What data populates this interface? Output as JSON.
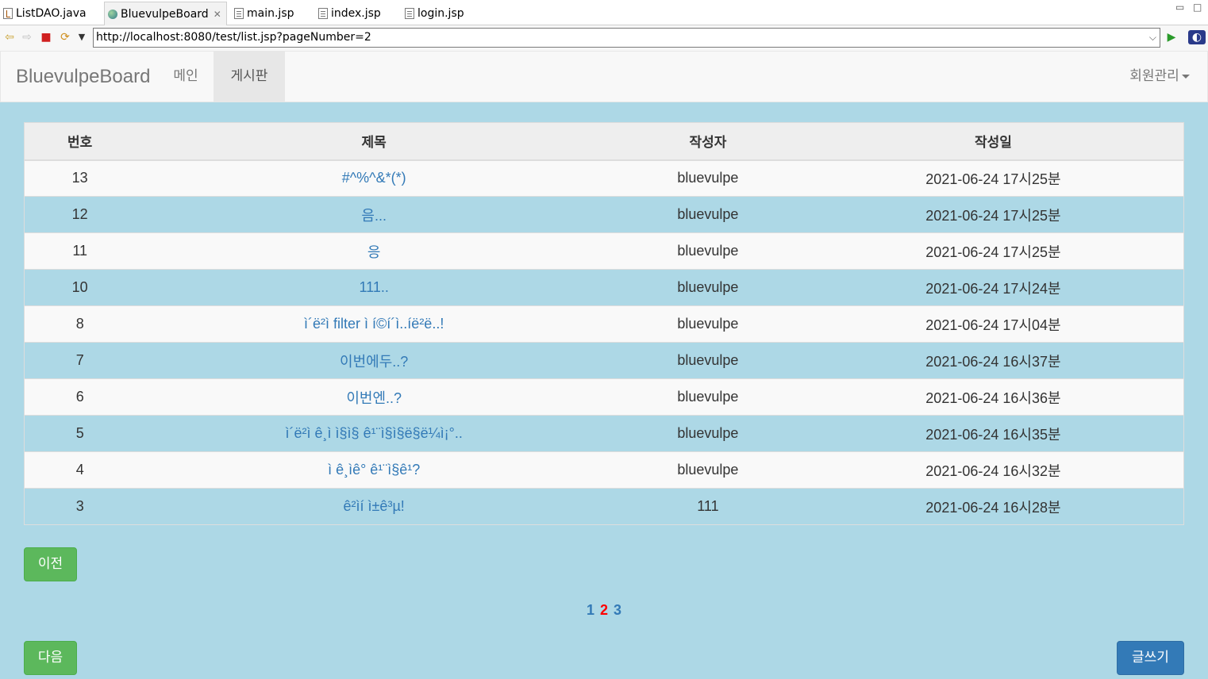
{
  "editor_tabs": [
    {
      "label": "ListDAO.java",
      "icon": "java-file-icon"
    },
    {
      "label": "BluevulpeBoard",
      "icon": "globe-icon",
      "active": true
    },
    {
      "label": "main.jsp",
      "icon": "jsp-file-icon"
    },
    {
      "label": "index.jsp",
      "icon": "jsp-file-icon"
    },
    {
      "label": "login.jsp",
      "icon": "jsp-file-icon"
    }
  ],
  "browser": {
    "url": "http://localhost:8080/test/list.jsp?pageNumber=2"
  },
  "navbar": {
    "brand": "BluevulpeBoard",
    "items": [
      {
        "label": "메인"
      },
      {
        "label": "게시판",
        "active": true
      }
    ],
    "user_menu": "회원관리"
  },
  "table": {
    "headers": [
      "번호",
      "제목",
      "작성자",
      "작성일"
    ],
    "rows": [
      {
        "num": "13",
        "title": "#^%^&*(*)",
        "author": "bluevulpe",
        "date": "2021-06-24 17시25분"
      },
      {
        "num": "12",
        "title": "음...",
        "author": "bluevulpe",
        "date": "2021-06-24 17시25분"
      },
      {
        "num": "11",
        "title": "응",
        "author": "bluevulpe",
        "date": "2021-06-24 17시25분"
      },
      {
        "num": "10",
        "title": "111..",
        "author": "bluevulpe",
        "date": "2021-06-24 17시24분"
      },
      {
        "num": "8",
        "title": "ì´ë²ì filter ì í©í´ì..íë²ë..!",
        "author": "bluevulpe",
        "date": "2021-06-24 17시04분"
      },
      {
        "num": "7",
        "title": "이번에두..?",
        "author": "bluevulpe",
        "date": "2021-06-24 16시37분"
      },
      {
        "num": "6",
        "title": "이번엔..?",
        "author": "bluevulpe",
        "date": "2021-06-24 16시36분"
      },
      {
        "num": "5",
        "title": "ì´ë²ì ê¸ì ì§ì§ ê¹¨ì§ì§ë§ë¼ì¡°..",
        "author": "bluevulpe",
        "date": "2021-06-24 16시35분"
      },
      {
        "num": "4",
        "title": "ì ê¸ìê° ê¹¨ì§ê¹?",
        "author": "bluevulpe",
        "date": "2021-06-24 16시32분"
      },
      {
        "num": "3",
        "title": "ê²ìí ì±ê³µ!",
        "author": "111",
        "date": "2021-06-24 16시28분"
      }
    ]
  },
  "buttons": {
    "prev": "이전",
    "next": "다음",
    "write": "글쓰기"
  },
  "pagination": {
    "pages": [
      "1",
      "2",
      "3"
    ],
    "current": "2"
  },
  "colors": {
    "background": "#add8e6",
    "link": "#337ab7",
    "current_page": "#ff0000",
    "success": "#5cb85c",
    "primary": "#337ab7"
  }
}
